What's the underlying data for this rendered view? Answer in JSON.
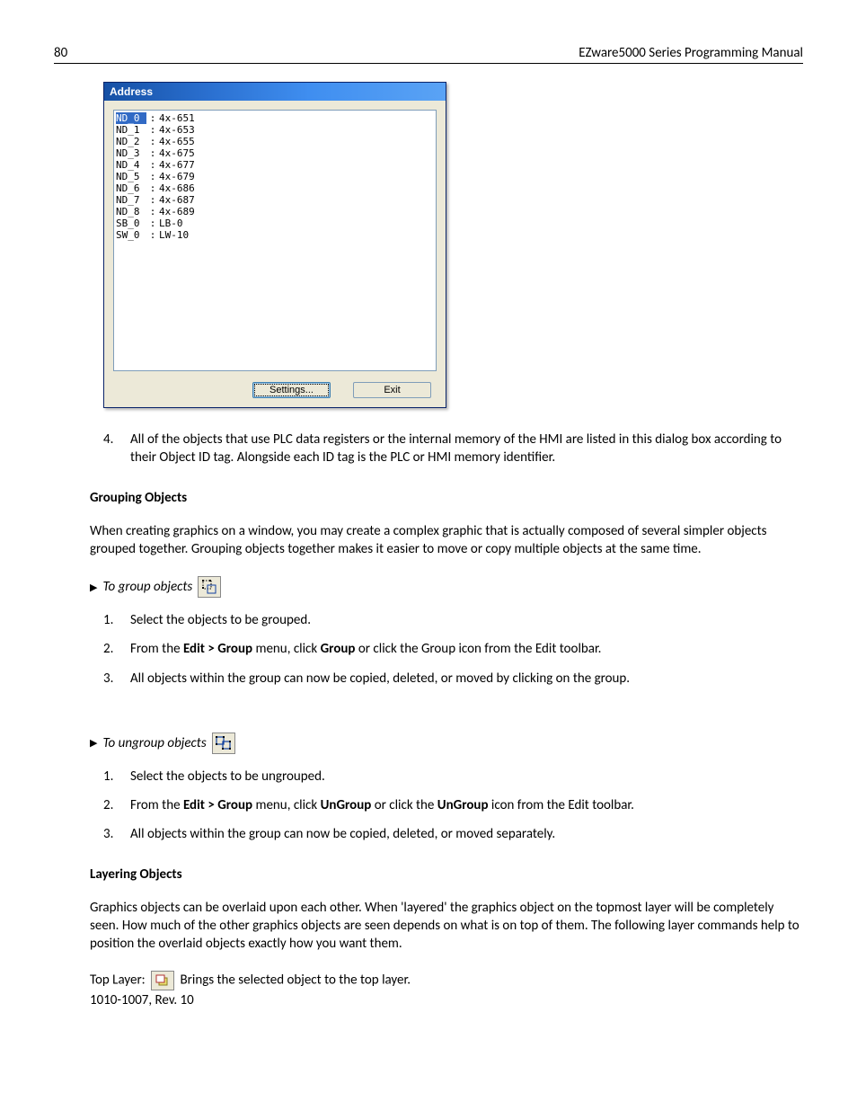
{
  "header": {
    "page_num": "80",
    "title": "EZware5000 Series Programming Manual"
  },
  "dialog": {
    "title": "Address",
    "rows": [
      {
        "id": "ND_0",
        "val": "4x-651",
        "sel": true
      },
      {
        "id": "ND_1",
        "val": "4x-653",
        "sel": false
      },
      {
        "id": "ND_2",
        "val": "4x-655",
        "sel": false
      },
      {
        "id": "ND_3",
        "val": "4x-675",
        "sel": false
      },
      {
        "id": "ND_4",
        "val": "4x-677",
        "sel": false
      },
      {
        "id": "ND_5",
        "val": "4x-679",
        "sel": false
      },
      {
        "id": "ND_6",
        "val": "4x-686",
        "sel": false
      },
      {
        "id": "ND_7",
        "val": "4x-687",
        "sel": false
      },
      {
        "id": "ND_8",
        "val": "4x-689",
        "sel": false
      },
      {
        "id": "SB_0",
        "val": "LB-0",
        "sel": false
      },
      {
        "id": "SW_0",
        "val": "LW-10",
        "sel": false
      }
    ],
    "settings_btn": "Settings...",
    "exit_btn": "Exit"
  },
  "item4": {
    "num": "4.",
    "text": "All of the objects that use PLC data registers or the internal memory of the HMI are listed in this dialog box according to their Object ID tag. Alongside each ID tag is the PLC or HMI memory identifier."
  },
  "grouping": {
    "heading": "Grouping Objects",
    "para": "When creating graphics on a window, you may create a complex graphic that is actually composed of several simpler objects grouped together. Grouping objects together makes it easier to move or copy multiple objects at the same time.",
    "group_task": "To group objects",
    "group_steps": [
      {
        "num": "1.",
        "pre": "",
        "bold1": "",
        "mid": "Select the objects to be grouped.",
        "bold2": "",
        "post": ""
      },
      {
        "num": "2.",
        "pre": "From the ",
        "bold1": "Edit > Group",
        "mid": " menu, click ",
        "bold2": "Group",
        "post": " or click the Group icon from the Edit toolbar."
      },
      {
        "num": "3.",
        "pre": "",
        "bold1": "",
        "mid": "All objects within the group can now be copied, deleted, or moved by clicking on the group.",
        "bold2": "",
        "post": ""
      }
    ],
    "ungroup_task": "To ungroup objects",
    "ungroup_steps": [
      {
        "num": "1.",
        "pre": "",
        "bold1": "",
        "mid": "Select the objects to be ungrouped.",
        "bold2": "",
        "post": ""
      },
      {
        "num": "2.",
        "pre": "From the ",
        "bold1": "Edit > Group",
        "mid": " menu, click ",
        "bold2": "UnGroup",
        "post_pre": " or click the ",
        "bold3": "UnGroup",
        "post": " icon from the Edit toolbar."
      },
      {
        "num": "3.",
        "pre": "",
        "bold1": "",
        "mid": "All objects within the group can now be copied, deleted, or moved separately.",
        "bold2": "",
        "post": ""
      }
    ]
  },
  "layering": {
    "heading": "Layering Objects",
    "para": "Graphics objects can be overlaid upon each other. When 'layered' the graphics object on the topmost layer will be completely seen. How much of the other graphics objects are seen depends on what is on top of them. The following layer commands help to position the overlaid objects exactly how you want them.",
    "toplayer_label": "Top Layer:",
    "toplayer_desc": " Brings the selected object to the top layer."
  },
  "footer_rev": "1010-1007, Rev. 10"
}
